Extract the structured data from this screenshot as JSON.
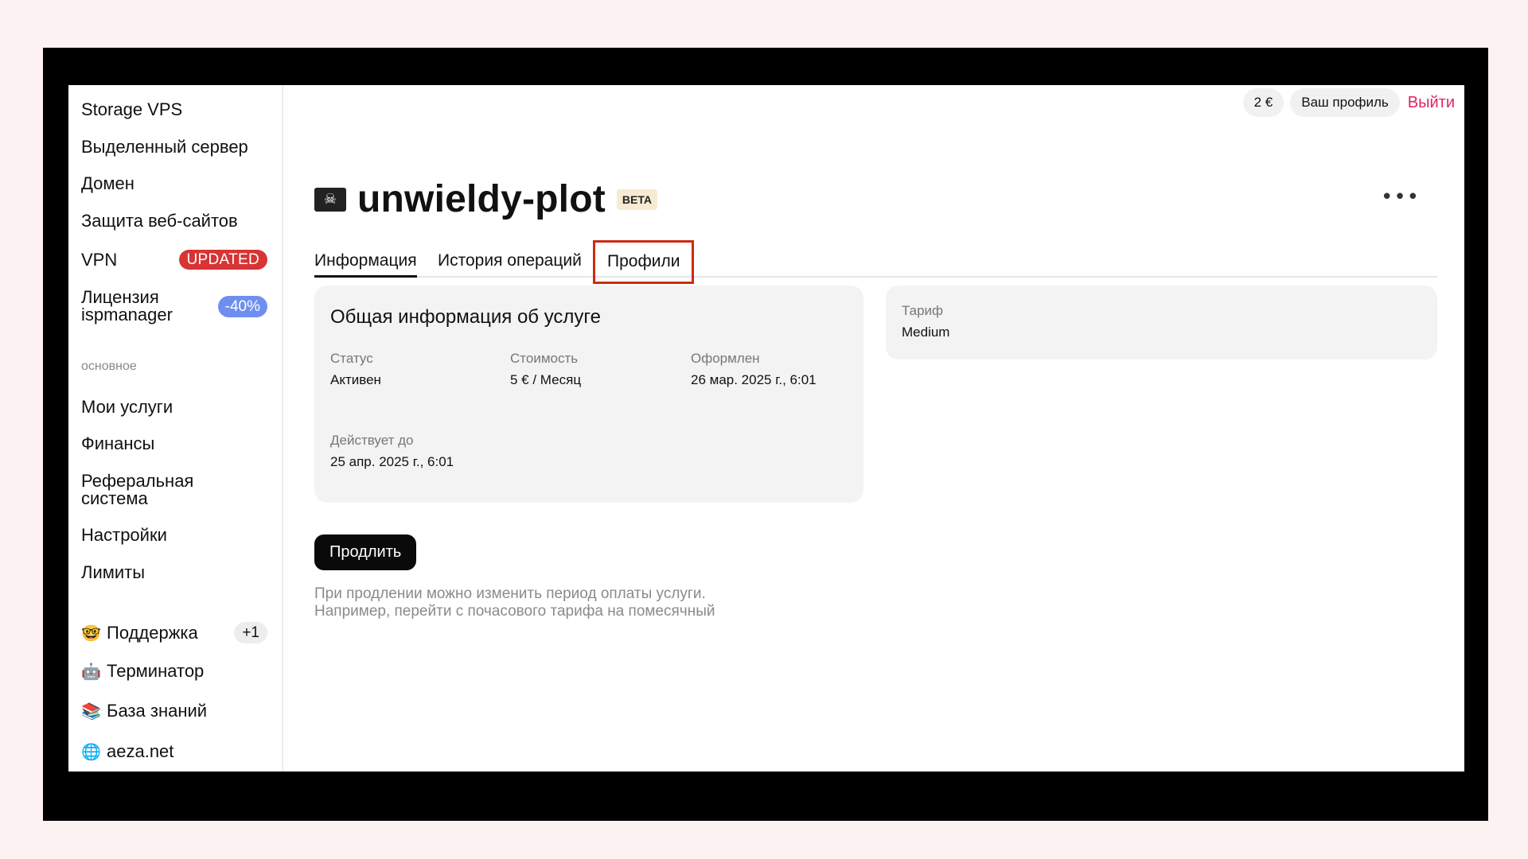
{
  "header": {
    "balance": "2 €",
    "profile_label": "Ваш профиль",
    "logout_label": "Выйти"
  },
  "sidebar": {
    "top_items": [
      {
        "label": "Storage VPS"
      },
      {
        "label": "Выделенный сервер"
      },
      {
        "label": "Домен"
      },
      {
        "label": "Защита веб-сайтов"
      },
      {
        "label": "VPN",
        "badge": "UPDATED"
      },
      {
        "label": "Лицензия ispmanager",
        "badge": "-40%"
      }
    ],
    "section_label": "основное",
    "main_items": [
      {
        "label": "Мои услуги"
      },
      {
        "label": "Финансы"
      },
      {
        "label": "Реферальная система"
      },
      {
        "label": "Настройки"
      },
      {
        "label": "Лимиты"
      }
    ],
    "bottom_items": [
      {
        "label": "Поддержка",
        "icon": "nerd-face-emoji-icon",
        "badge": "+1"
      },
      {
        "label": "Терминатор",
        "icon": "robot-emoji-icon"
      },
      {
        "label": "База знаний",
        "icon": "books-emoji-icon"
      },
      {
        "label": "aeza.net",
        "icon": "globe-emoji-icon"
      }
    ]
  },
  "page": {
    "title": "unwieldy-plot",
    "beta_label": "BETA",
    "tabs": [
      {
        "label": "Информация"
      },
      {
        "label": "История операций"
      },
      {
        "label": "Профили"
      }
    ]
  },
  "info_card": {
    "title": "Общая информация об услуге",
    "fields": [
      {
        "label": "Статус",
        "value": "Активен"
      },
      {
        "label": "Стоимость",
        "value": "5 € / Месяц"
      },
      {
        "label": "Оформлен",
        "value": "26 мар. 2025 г., 6:01"
      },
      {
        "label": "Действует до",
        "value": "25 апр. 2025 г., 6:01"
      }
    ]
  },
  "tariff_card": {
    "label": "Тариф",
    "value": "Medium"
  },
  "renew": {
    "button_label": "Продлить",
    "note_line1": "При продлении можно изменить период оплаты услуги.",
    "note_line2": "Например, перейти с почасового тарифа на помесячный"
  },
  "colors": {
    "accent_red": "#d83434",
    "discount_blue": "#6f8ff0",
    "logout_pink": "#e0245e",
    "highlight_border": "#cc2b12"
  }
}
